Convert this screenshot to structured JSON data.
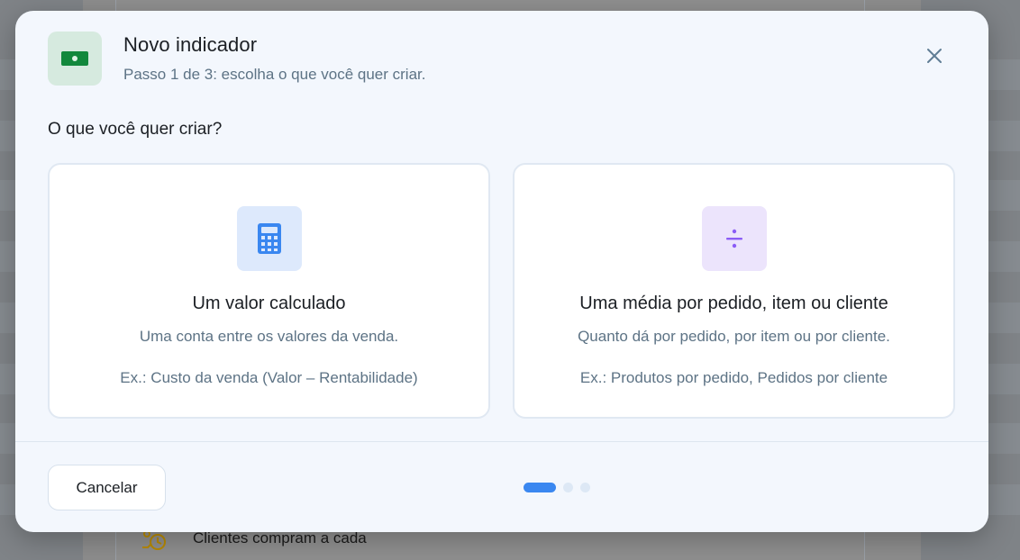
{
  "background": {
    "row_label": "Clientes compram a cada",
    "row_icon": "clock-hand-icon"
  },
  "modal": {
    "icon": "money-bill-icon",
    "title": "Novo indicador",
    "subtitle": "Passo 1 de 3: escolha o que você quer criar.",
    "close_icon": "close-icon",
    "question": "O que você quer criar?",
    "options": [
      {
        "icon": "calculator-icon",
        "title": "Um valor calculado",
        "description": "Uma conta entre os valores da venda.",
        "example": "Ex.: Custo da venda (Valor – Rentabilidade)"
      },
      {
        "icon": "divide-icon",
        "title": "Uma média por pedido, item ou cliente",
        "description": "Quanto dá por pedido, por item ou por cliente.",
        "example": "Ex.: Produtos por pedido, Pedidos por cliente"
      }
    ],
    "cancel_label": "Cancelar",
    "steps": {
      "current": 1,
      "total": 3
    }
  },
  "colors": {
    "accent": "#3a87f0",
    "calculator_blue": "#3a87f0",
    "divide_purple": "#8b5cf6",
    "money_green": "#12883c"
  }
}
